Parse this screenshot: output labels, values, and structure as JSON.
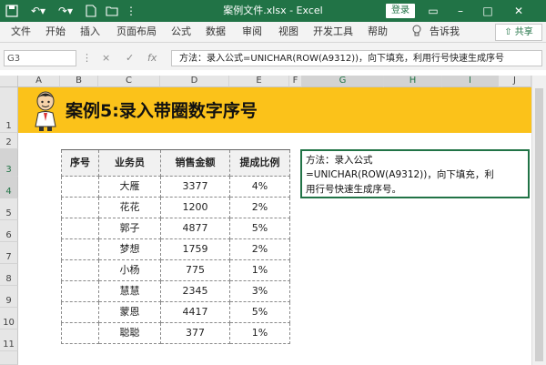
{
  "window": {
    "title": "案例文件.xlsx - Excel",
    "login_label": "登录",
    "share_label": "共享",
    "colors": {
      "accent": "#217346",
      "banner": "#fbc21a"
    }
  },
  "ribbon": {
    "tabs": [
      "文件",
      "开始",
      "插入",
      "页面布局",
      "公式",
      "数据",
      "审阅",
      "视图",
      "开发工具",
      "帮助"
    ],
    "tell_me": "告诉我"
  },
  "formula_bar": {
    "name_box": "G3",
    "cancel_icon": "×",
    "enter_icon": "✓",
    "fx_label": "fx",
    "formula": "方法：录入公式=UNICHAR(ROW(A9312))，向下填充，利用行号快速生成序号"
  },
  "columns": [
    "A",
    "B",
    "C",
    "D",
    "E",
    "F",
    "G",
    "H",
    "I",
    "J"
  ],
  "rows": [
    "1",
    "2",
    "3",
    "4",
    "5",
    "6",
    "7",
    "8",
    "9",
    "10",
    "11"
  ],
  "banner": {
    "title": "案例5:录入带圈数字序号"
  },
  "table": {
    "headers": [
      "序号",
      "业务员",
      "销售金额",
      "提成比例"
    ],
    "rows": [
      [
        "",
        "大雁",
        "3377",
        "4%"
      ],
      [
        "",
        "花花",
        "1200",
        "2%"
      ],
      [
        "",
        "郭子",
        "4877",
        "5%"
      ],
      [
        "",
        "梦想",
        "1759",
        "2%"
      ],
      [
        "",
        "小杨",
        "775",
        "1%"
      ],
      [
        "",
        "慧慧",
        "2345",
        "3%"
      ],
      [
        "",
        "蒙恩",
        "4417",
        "5%"
      ],
      [
        "",
        "聪聪",
        "377",
        "1%"
      ]
    ]
  },
  "note": {
    "line1": "方法：录入公式",
    "line2": "=UNICHAR(ROW(A9312))，向下填充，利",
    "line3": "用行号快速生成序号。"
  }
}
